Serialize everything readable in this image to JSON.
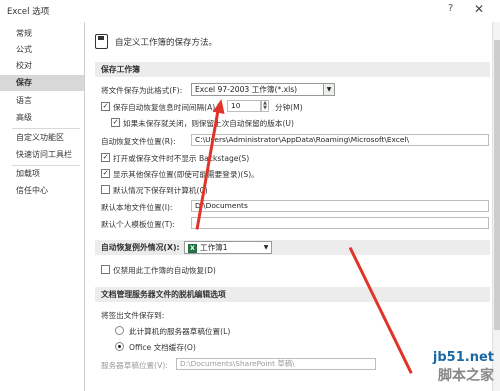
{
  "window": {
    "title": "Excel 选项",
    "help": "?",
    "close": "✕"
  },
  "sidebar": {
    "items": [
      {
        "label": "常规"
      },
      {
        "label": "公式"
      },
      {
        "label": "校对"
      },
      {
        "label": "保存",
        "active": true
      },
      {
        "label": "语言"
      },
      {
        "label": "高级"
      },
      {
        "label": "自定义功能区"
      },
      {
        "label": "快速访问工具栏"
      },
      {
        "label": "加载项"
      },
      {
        "label": "信任中心"
      }
    ]
  },
  "header": {
    "text": "自定义工作簿的保存方法。"
  },
  "save_workbooks": {
    "section_title": "保存工作簿",
    "format_label": "将文件保存为此格式(F):",
    "format_value": "Excel 97-2003 工作簿(*.xls)",
    "autorecover_label": "保存自动恢复信息时间间隔(A)",
    "autorecover_value": "10",
    "minutes_label": "分钟(M)",
    "keep_last_label": "如果未保存就关闭，则保留上次自动保留的版本(U)",
    "autorecover_location_label": "自动恢复文件位置(R):",
    "autorecover_location_value": "C:\\Users\\Administrator\\AppData\\Roaming\\Microsoft\\Excel\\",
    "no_backstage_label": "打开或保存文件时不显示 Backstage(S)",
    "show_more_locations_label": "显示其他保存位置(即使可能需要登录)(S)。",
    "default_computer_label": "默认情况下保存到计算机(C)",
    "default_local_label": "默认本地文件位置(I):",
    "default_local_value": "D:\\Documents",
    "personal_templates_label": "默认个人模板位置(T):",
    "personal_templates_value": ""
  },
  "autorecover_exceptions": {
    "label": "自动恢复例外情况(X):",
    "workbook_value": "工作簿1",
    "disable_label": "仅禁用此工作簿的自动恢复(D)"
  },
  "offline_editing": {
    "section_title": "文档管理服务器文件的脱机编辑选项",
    "save_checked_out_label": "将签出文件保存到:",
    "option_server_label": "此计算机的服务器草稿位置(L)",
    "option_office_cache_label": "Office 文档缓存(O)",
    "server_drafts_label": "服务器草稿位置(V):",
    "server_drafts_value": "D:\\Documents\\SharePoint 草稿\\"
  },
  "watermark": {
    "site": "jb51.net",
    "site2": "脚本之家"
  },
  "colors": {
    "annotation_arrow": "#e0342b",
    "active_sidebar": "#d8d8d8"
  }
}
